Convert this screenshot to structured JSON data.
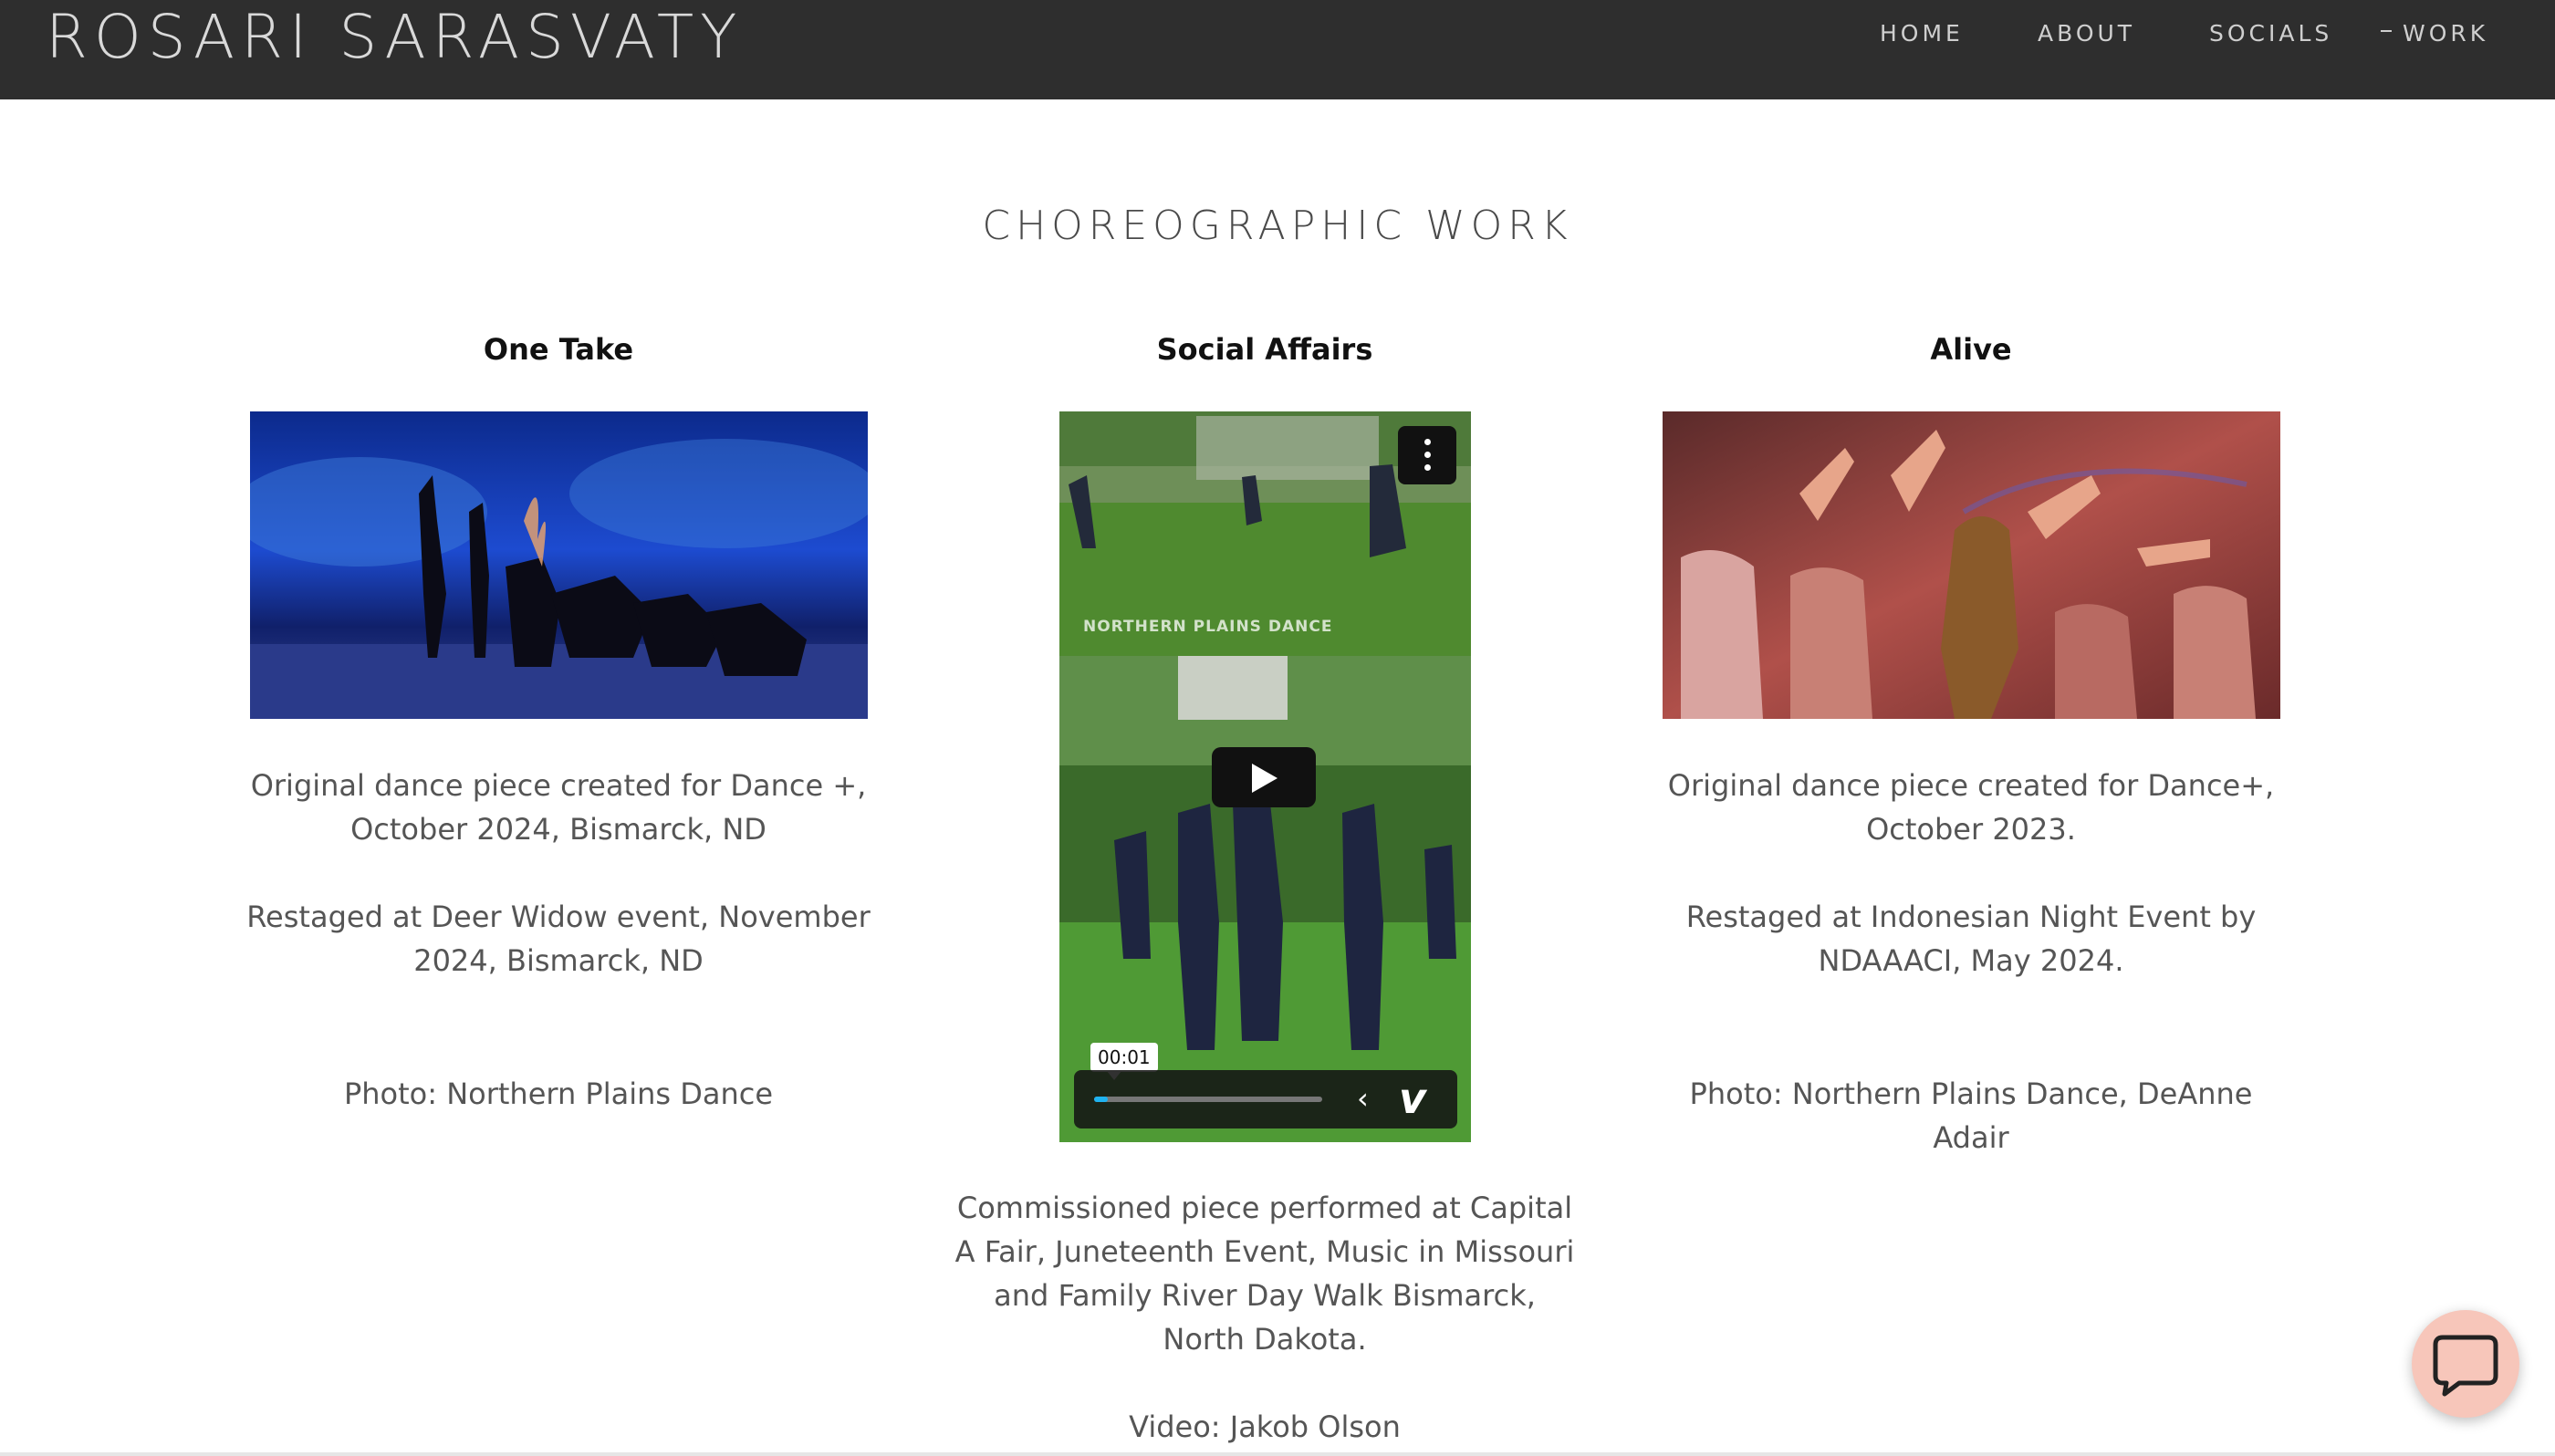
{
  "header": {
    "brand": "ROSARI SARASVATY",
    "nav": [
      "HOME",
      "ABOUT",
      "SOCIALS",
      "WORK"
    ]
  },
  "page": {
    "title": "CHOREOGRAPHIC WORK"
  },
  "works": [
    {
      "title": "One Take",
      "desc1": [
        "Original dance piece created for Dance +,",
        "October 2024, Bismarck, ND"
      ],
      "desc2": [
        "Restaged at Deer Widow event, November",
        "2024, Bismarck, ND"
      ],
      "credit": "Photo: Northern Plains Dance"
    },
    {
      "title": "Social Affairs",
      "video": {
        "timecode": "00:01",
        "watermark": "NORTHERN PLAINS DANCE",
        "progress": 0.06
      },
      "desc1": [
        "Commissioned piece performed at Capital",
        "A Fair, Juneteenth Event, Music in Missouri",
        "and Family River Day Walk Bismarck,",
        "North Dakota."
      ],
      "credit": "Video: Jakob Olson"
    },
    {
      "title": "Alive",
      "desc1": [
        "Original dance piece created for Dance+,",
        "October 2023."
      ],
      "desc2": [
        "Restaged at Indonesian Night Event by",
        "NDAAACI, May 2024."
      ],
      "credit": "Photo: Northern Plains Dance, DeAnne Adair"
    }
  ],
  "colors": {
    "header_bg": "#2e2e2e",
    "accent_progress": "#1fb3f0",
    "chat_bubble": "#f7c6ba"
  }
}
